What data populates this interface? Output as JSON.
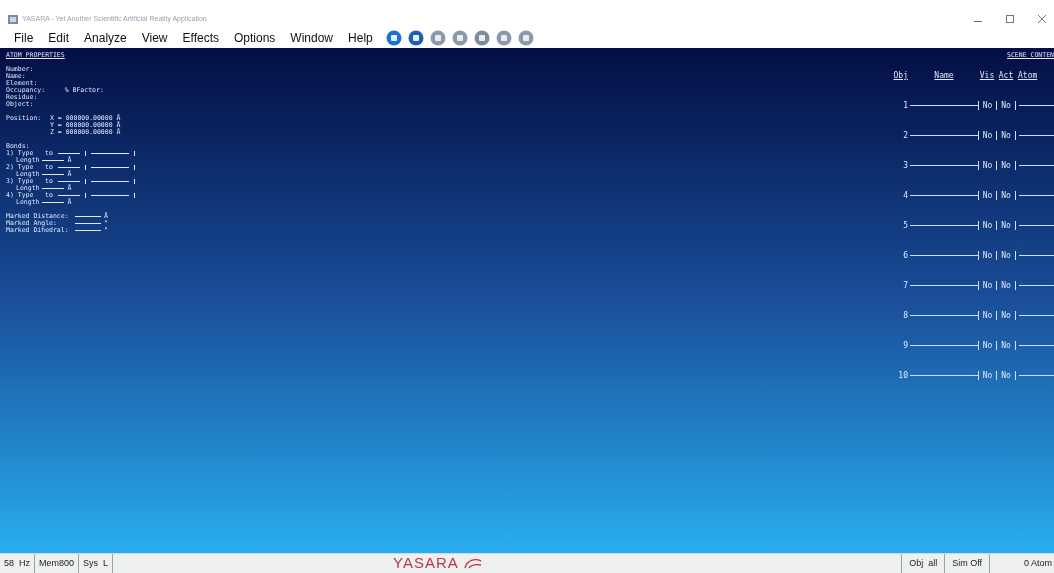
{
  "window": {
    "title": "YASARA - Yet Another Scientific Artificial Reality Application"
  },
  "menu": [
    "File",
    "Edit",
    "Analyze",
    "View",
    "Effects",
    "Options",
    "Window",
    "Help"
  ],
  "atom_properties": {
    "title": "ATOM PROPERTIES",
    "fields": [
      "Number:",
      "Name:",
      "Element:",
      "Occupancy:     % BFactor:",
      "Residue:",
      "Object:"
    ],
    "position_label": "Position:",
    "position": [
      "X = 000000.00000 Å",
      "Y = 000000.00000 Å",
      "Z = 000000.00000 Å"
    ],
    "bonds_label": "Bonds:",
    "bonds": [
      {
        "type": "1) Type",
        "to": "to",
        "length": "Length",
        "unit": "Å"
      },
      {
        "type": "2) Type",
        "to": "to",
        "length": "Length",
        "unit": "Å"
      },
      {
        "type": "3) Type",
        "to": "to",
        "length": "Length",
        "unit": "Å"
      },
      {
        "type": "4) Type",
        "to": "to",
        "length": "Length",
        "unit": "Å"
      }
    ],
    "marked": [
      {
        "label": "Marked Distance:",
        "unit": "Å"
      },
      {
        "label": "Marked Angle:",
        "unit": "°"
      },
      {
        "label": "Marked Dihedral:",
        "unit": "°"
      }
    ]
  },
  "scene_content": {
    "title": "SCENE CONTEN",
    "columns": [
      "Obj",
      "Name",
      "Vis",
      "Act",
      "Atom"
    ],
    "rows": [
      {
        "obj": "1",
        "vis": "No",
        "act": "No"
      },
      {
        "obj": "2",
        "vis": "No",
        "act": "No"
      },
      {
        "obj": "3",
        "vis": "No",
        "act": "No"
      },
      {
        "obj": "4",
        "vis": "No",
        "act": "No"
      },
      {
        "obj": "5",
        "vis": "No",
        "act": "No"
      },
      {
        "obj": "6",
        "vis": "No",
        "act": "No"
      },
      {
        "obj": "7",
        "vis": "No",
        "act": "No"
      },
      {
        "obj": "8",
        "vis": "No",
        "act": "No"
      },
      {
        "obj": "9",
        "vis": "No",
        "act": "No"
      },
      {
        "obj": "10",
        "vis": "No",
        "act": "No"
      }
    ]
  },
  "status_bar": {
    "left": [
      "58  Hz",
      "Mem800",
      "Sys  L"
    ],
    "logo": "YASARA",
    "right": [
      "Obj  all",
      "Sim Off",
      "0 Atom"
    ]
  }
}
